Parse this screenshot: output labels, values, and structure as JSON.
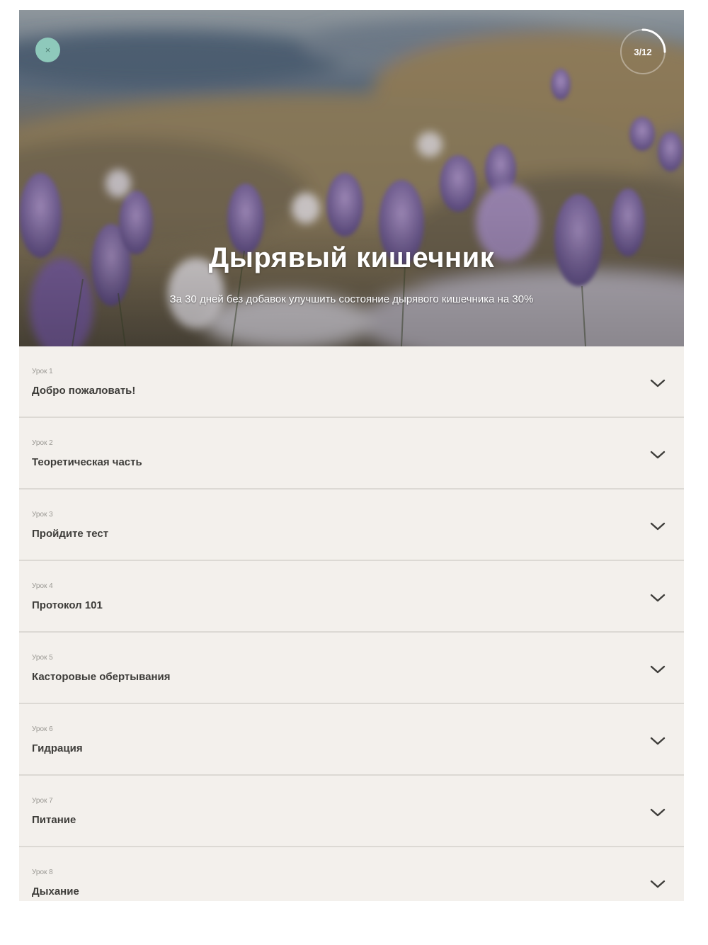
{
  "header": {
    "close_label": "×",
    "progress_label": "3/12",
    "progress_value": 0.25,
    "title": "Дырявый кишечник",
    "subtitle": "За 30 дней без добавок улучшить состояние дырявого кишечника на 30%"
  },
  "colors": {
    "accent": "#8ec9bb",
    "card_background": "#f3f0ec",
    "divider": "#dcd9d4",
    "title_text": "#3e3d3a",
    "label_text": "#9a9893"
  },
  "icons": {
    "close": "close-icon",
    "chevron": "chevron-down-icon"
  },
  "lessons": [
    {
      "number": "Урок 1",
      "title": "Добро пожаловать!"
    },
    {
      "number": "Урок 2",
      "title": "Теоретическая часть"
    },
    {
      "number": "Урок 3",
      "title": "Пройдите тест"
    },
    {
      "number": "Урок 4",
      "title": "Протокол 101"
    },
    {
      "number": "Урок 5",
      "title": "Касторовые обертывания"
    },
    {
      "number": "Урок 6",
      "title": "Гидрация"
    },
    {
      "number": "Урок 7",
      "title": "Питание"
    },
    {
      "number": "Урок 8",
      "title": "Дыхание"
    }
  ]
}
